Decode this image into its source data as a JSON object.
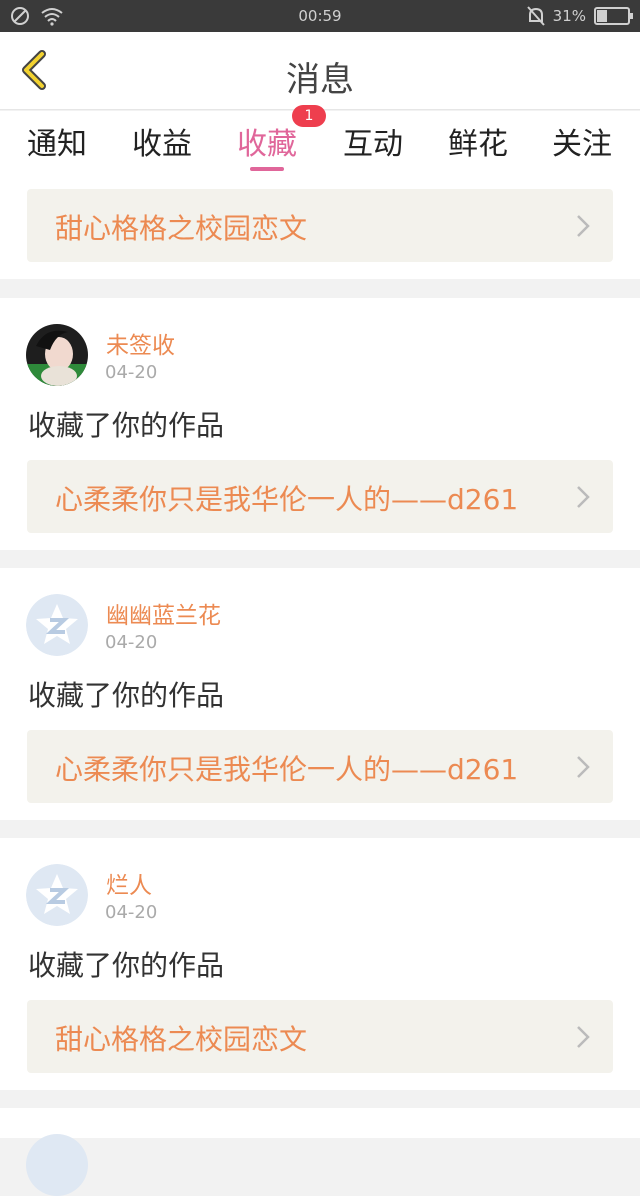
{
  "status_bar": {
    "time": "00:59",
    "battery": "31%"
  },
  "header": {
    "title": "消息"
  },
  "tabs": [
    {
      "label": "通知"
    },
    {
      "label": "收益"
    },
    {
      "label": "收藏",
      "badge": "1"
    },
    {
      "label": "互动"
    },
    {
      "label": "鲜花"
    },
    {
      "label": "关注"
    }
  ],
  "colors": {
    "accent": "#e0669a",
    "work_title": "#ec8a52",
    "badge": "#ee3e4e"
  },
  "top_work": {
    "title": "甜心格格之校园恋文"
  },
  "items": [
    {
      "user": "未签收",
      "date": "04-20",
      "action": "收藏了你的作品",
      "work": "心柔柔你只是我华伦一人的——d261",
      "avatar": "photo"
    },
    {
      "user": "幽幽蓝兰花",
      "date": "04-20",
      "action": "收藏了你的作品",
      "work": "心柔柔你只是我华伦一人的——d261",
      "avatar": "default-z-icon"
    },
    {
      "user": "烂人",
      "date": "04-20",
      "action": "收藏了你的作品",
      "work": "甜心格格之校园恋文",
      "avatar": "default-z-icon"
    }
  ]
}
